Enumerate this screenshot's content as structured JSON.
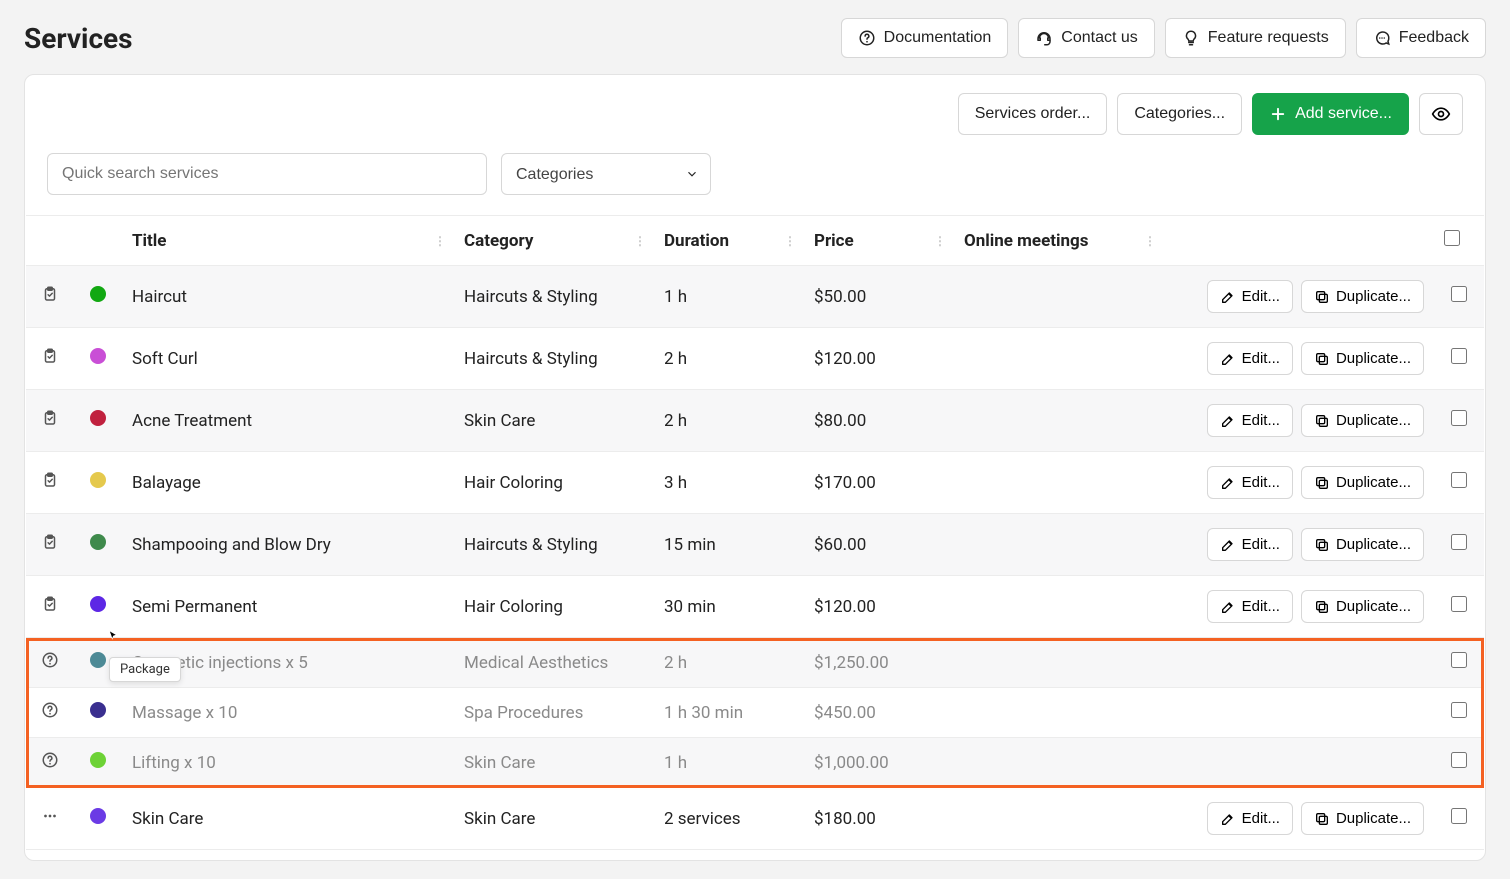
{
  "page_title": "Services",
  "header_buttons": {
    "documentation": "Documentation",
    "contact_us": "Contact us",
    "feature_requests": "Feature requests",
    "feedback": "Feedback"
  },
  "toolbar": {
    "services_order": "Services order...",
    "categories": "Categories...",
    "add_service": "Add service..."
  },
  "filters": {
    "search_placeholder": "Quick search services",
    "category_label": "Categories"
  },
  "columns": {
    "title": "Title",
    "category": "Category",
    "duration": "Duration",
    "price": "Price",
    "online": "Online meetings"
  },
  "row_actions": {
    "edit": "Edit...",
    "duplicate": "Duplicate..."
  },
  "tooltip_label": "Package",
  "services": [
    {
      "icon": "clipboard",
      "dot": "#12a812",
      "title": "Haircut",
      "category": "Haircuts & Styling",
      "duration": "1 h",
      "price": "$50.00",
      "has_actions": true,
      "alt": true
    },
    {
      "icon": "clipboard",
      "dot": "#c94fd6",
      "title": "Soft Curl",
      "category": "Haircuts & Styling",
      "duration": "2 h",
      "price": "$120.00",
      "has_actions": true,
      "alt": false
    },
    {
      "icon": "clipboard",
      "dot": "#c0213e",
      "title": "Acne Treatment",
      "category": "Skin Care",
      "duration": "2 h",
      "price": "$80.00",
      "has_actions": true,
      "alt": true
    },
    {
      "icon": "clipboard",
      "dot": "#e5c94d",
      "title": "Balayage",
      "category": "Hair Coloring",
      "duration": "3 h",
      "price": "$170.00",
      "has_actions": true,
      "alt": false
    },
    {
      "icon": "clipboard",
      "dot": "#3f8a4c",
      "title": "Shampooing and Blow Dry",
      "category": "Haircuts & Styling",
      "duration": "15 min",
      "price": "$60.00",
      "has_actions": true,
      "alt": true
    },
    {
      "icon": "clipboard",
      "dot": "#5d27e5",
      "title": "Semi Permanent",
      "category": "Hair Coloring",
      "duration": "30 min",
      "price": "$120.00",
      "has_actions": true,
      "alt": false
    }
  ],
  "packages": [
    {
      "icon": "help",
      "dot": "#4d8a96",
      "title": "Cosmetic injections x 5",
      "category": "Medical Aesthetics",
      "duration": "2 h",
      "price": "$1,250.00",
      "has_actions": false,
      "alt": true
    },
    {
      "icon": "help",
      "dot": "#3a2f8f",
      "title": "Massage x 10",
      "category": "Spa Procedures",
      "duration": "1 h 30 min",
      "price": "$450.00",
      "has_actions": false,
      "alt": false
    },
    {
      "icon": "help",
      "dot": "#6dd236",
      "title": "Lifting x 10",
      "category": "Skin Care",
      "duration": "1 h",
      "price": "$1,000.00",
      "has_actions": false,
      "alt": true
    }
  ],
  "footer_rows": [
    {
      "icon": "dots",
      "dot": "#6b3be5",
      "title": "Skin Care",
      "category": "Skin Care",
      "duration": "2 services",
      "price": "$180.00",
      "has_actions": true,
      "alt": false
    }
  ]
}
